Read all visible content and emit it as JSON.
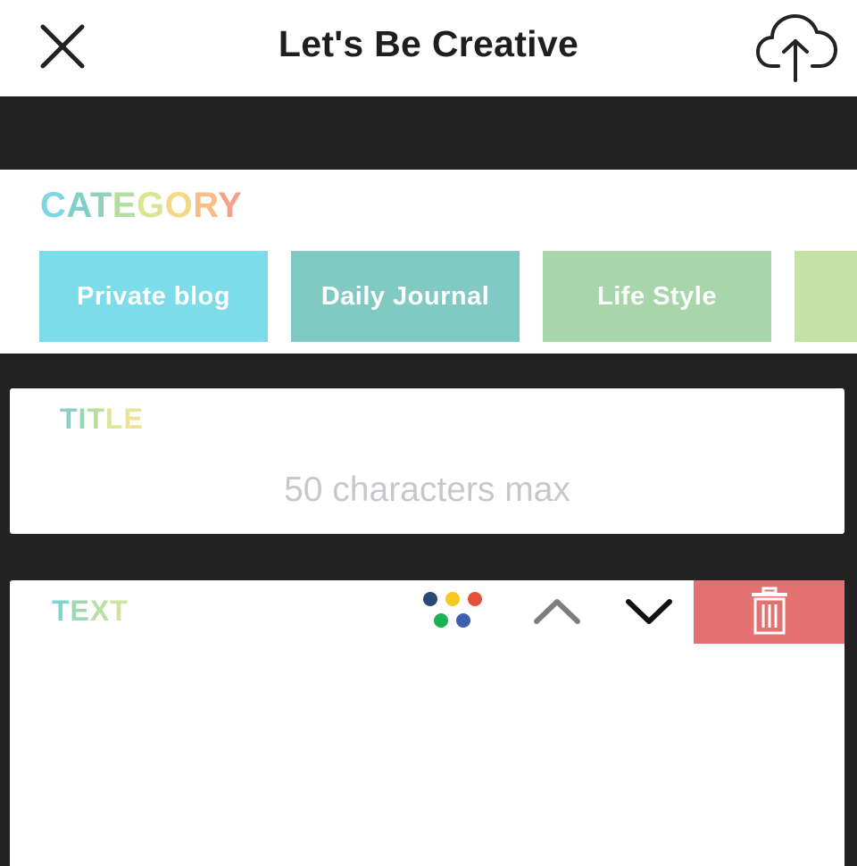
{
  "header": {
    "title": "Let's Be Creative",
    "close_icon": "close-icon",
    "upload_icon": "cloud-upload-icon"
  },
  "category": {
    "label_letters": [
      "C",
      "A",
      "T",
      "E",
      "G",
      "O",
      "R",
      "Y"
    ],
    "label_colors": [
      "#7fd6e3",
      "#7fcfc9",
      "#8fd2b7",
      "#b3dea1",
      "#d9e591",
      "#f4d985",
      "#f6bd86",
      "#f4a08c"
    ],
    "items": [
      {
        "label": "Private blog",
        "color": "#7ddce9"
      },
      {
        "label": "Daily Journal",
        "color": "#80cac3"
      },
      {
        "label": "Life Style",
        "color": "#a6d6a9"
      },
      {
        "label": "",
        "color": "#c6e3a7"
      }
    ]
  },
  "title_section": {
    "label_letters": [
      "T",
      "I",
      "T",
      "L",
      "E"
    ],
    "label_colors": [
      "#8ccdc4",
      "#98d5b3",
      "#b7dea1",
      "#d9e69c",
      "#f0e294"
    ],
    "placeholder": "50 characters max",
    "value": ""
  },
  "text_section": {
    "label_letters": [
      "T",
      "E",
      "X",
      "T"
    ],
    "label_colors": [
      "#82d3d0",
      "#9fd8b3",
      "#b9dfa4",
      "#cfe3a0"
    ],
    "palette_icon": "color-palette-icon",
    "palette_colors": [
      "#2b4a73",
      "#f6c923",
      "#e4503a",
      "#1db251",
      "#3f5fae"
    ],
    "move_up_icon": "chevron-up-icon",
    "move_down_icon": "chevron-down-icon",
    "delete_icon": "trash-icon",
    "delete_color": "#e37171",
    "value": ""
  }
}
